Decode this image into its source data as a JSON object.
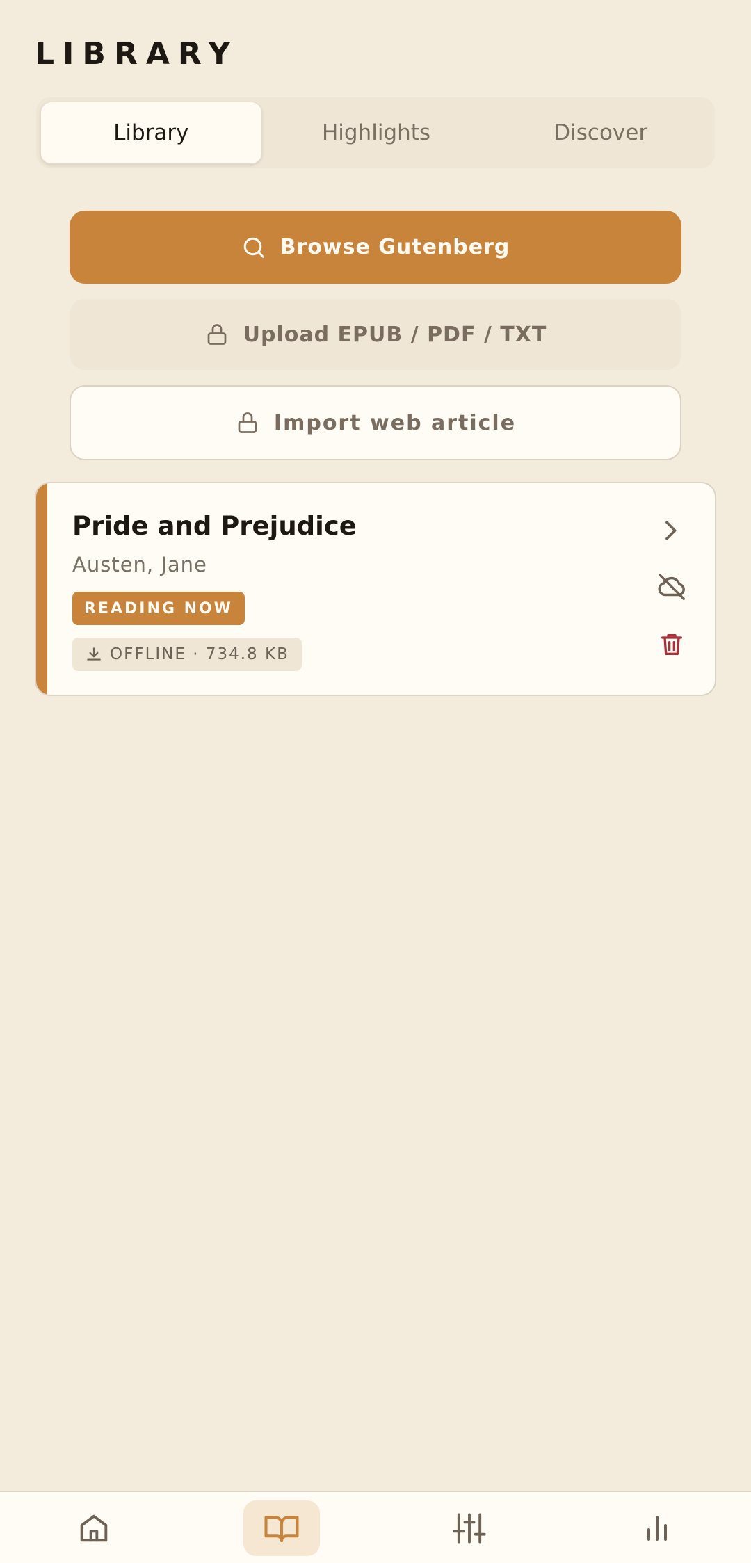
{
  "header": {
    "title": "LIBRARY"
  },
  "tabs": [
    {
      "label": "Library",
      "active": true
    },
    {
      "label": "Highlights",
      "active": false
    },
    {
      "label": "Discover",
      "active": false
    }
  ],
  "actions": {
    "browse_label": "Browse Gutenberg",
    "upload_label": "Upload EPUB / PDF / TXT",
    "import_label": "Import web article"
  },
  "books": [
    {
      "title": "Pride and Prejudice",
      "author": "Austen, Jane",
      "status_badge": "READING NOW",
      "offline_badge": "OFFLINE · 734.8 KB"
    }
  ],
  "icons": {
    "browse": "search-icon",
    "upload": "lock-icon",
    "import": "lock-icon",
    "open": "chevron-right-icon",
    "cloud": "cloud-off-icon",
    "delete": "trash-icon",
    "offline": "download-icon",
    "nav": [
      "home-icon",
      "book-open-icon",
      "sliders-icon",
      "bar-chart-icon"
    ]
  },
  "colors": {
    "accent": "#c9843c",
    "background": "#f3ecdc",
    "card": "#fffcf5",
    "danger": "#a8323a"
  },
  "bottom_nav": {
    "active_index": 1
  }
}
